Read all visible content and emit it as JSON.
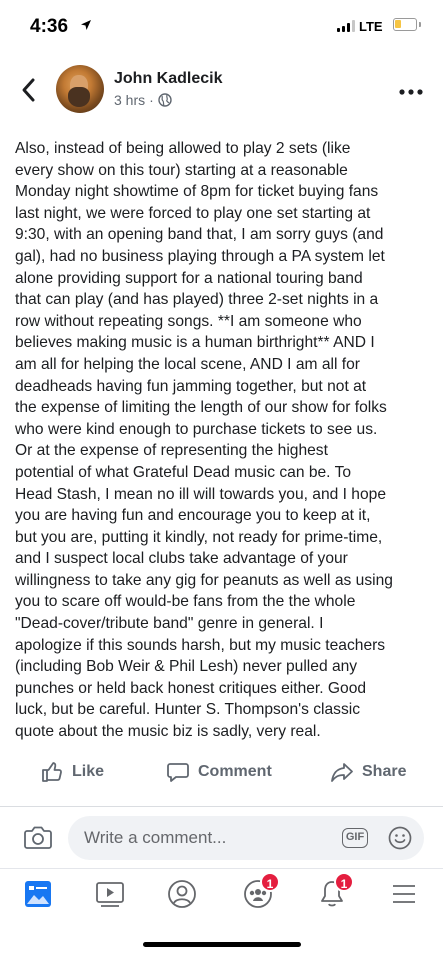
{
  "status_bar": {
    "time": "4:36",
    "network": "LTE",
    "battery_color": "#f6c544"
  },
  "post": {
    "author": "John Kadlecik",
    "time_ago": "3 hrs",
    "separator": "·",
    "privacy_icon": "globe-icon",
    "lines": [
      "Also, instead of being allowed to play 2 sets (like",
      "every show on this tour) starting at a reasonable",
      "Monday night showtime of 8pm for ticket buying fans",
      "last night, we were forced to play one set starting at",
      "9:30, with an opening band that, I am sorry guys (and",
      "gal), had no business playing through a PA system let",
      "alone providing support for a national touring band",
      "that can play (and has played) three 2-set nights in a",
      "row without repeating songs. **I am someone who",
      "believes making music is a human birthright** AND I",
      "am all for helping the local scene, AND I am all for",
      "deadheads having fun jamming together, but not at",
      "the expense of limiting the length of our show for folks",
      "who were kind enough to purchase tickets to see us.",
      "Or at the expense of representing the highest",
      "potential of what Grateful Dead music can be. To",
      "Head Stash, I mean no ill will towards you, and I hope",
      "you are having fun and encourage you to keep at it,",
      "but you are, putting it kindly, not ready for prime-time,",
      "and I suspect local clubs take advantage of your",
      "willingness to take any gig for peanuts as well as using",
      "you to scare off would-be fans from the the whole",
      "\"Dead-cover/tribute band\" genre in general. I",
      "apologize if this sounds harsh, but my music teachers",
      "(including Bob Weir & Phil Lesh) never pulled any",
      "punches or held back honest critiques either. Good",
      "luck, but be careful. Hunter S. Thompson's classic",
      "quote about the music biz is sadly, very real."
    ]
  },
  "actions": {
    "like": "Like",
    "comment": "Comment",
    "share": "Share"
  },
  "composer": {
    "placeholder": "Write a comment...",
    "gif_label": "GIF"
  },
  "nav": {
    "groups_badge": "1",
    "notifications_badge": "1",
    "active_color": "#1877f2",
    "icon_color": "#65676b"
  }
}
